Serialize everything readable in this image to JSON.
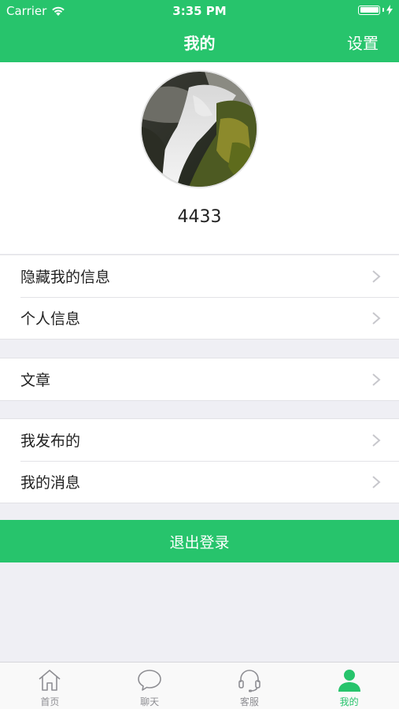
{
  "status": {
    "carrier": "Carrier",
    "time": "3:35 PM"
  },
  "nav": {
    "title": "我的",
    "right": "设置"
  },
  "profile": {
    "username": "4433"
  },
  "menu": {
    "group1": [
      {
        "label": "隐藏我的信息"
      },
      {
        "label": "个人信息"
      }
    ],
    "group2": [
      {
        "label": "文章"
      }
    ],
    "group3": [
      {
        "label": "我发布的"
      },
      {
        "label": "我的消息"
      }
    ]
  },
  "logout": {
    "label": "退出登录"
  },
  "tabs": [
    {
      "label": "首页",
      "icon": "home-icon"
    },
    {
      "label": "聊天",
      "icon": "chat-bubble-icon"
    },
    {
      "label": "客服",
      "icon": "headset-icon"
    },
    {
      "label": "我的",
      "icon": "person-icon",
      "active": true
    }
  ],
  "colors": {
    "accent": "#27c46c",
    "background": "#efeff4",
    "inactive": "#8e8e93"
  }
}
